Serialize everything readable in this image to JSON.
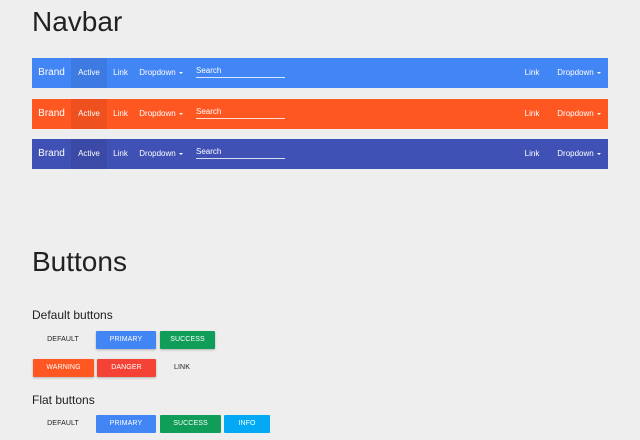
{
  "sections": {
    "navbar_title": "Navbar",
    "buttons_title": "Buttons",
    "default_buttons_title": "Default buttons",
    "flat_buttons_title": "Flat buttons"
  },
  "colors": {
    "navbar_blue": "#4285f4",
    "navbar_blue_active": "#3d7be2",
    "navbar_orange": "#ff5722",
    "navbar_orange_active": "#ef5020",
    "navbar_indigo": "#3f51b5",
    "navbar_indigo_active": "#3a4aa6",
    "primary": "#4285f4",
    "success": "#0f9d58",
    "warning": "#ff5722",
    "danger": "#f44336",
    "info": "#03a9f4"
  },
  "navbars": [
    {
      "brand": "Brand",
      "active": "Active",
      "link": "Link",
      "dropdown": "Dropdown",
      "search_placeholder": "Search",
      "right_link": "Link",
      "right_dropdown": "Dropdown"
    },
    {
      "brand": "Brand",
      "active": "Active",
      "link": "Link",
      "dropdown": "Dropdown",
      "search_placeholder": "Search",
      "right_link": "Link",
      "right_dropdown": "Dropdown"
    },
    {
      "brand": "Brand",
      "active": "Active",
      "link": "Link",
      "dropdown": "Dropdown",
      "search_placeholder": "Search",
      "right_link": "Link",
      "right_dropdown": "Dropdown"
    }
  ],
  "default_buttons": {
    "default": "DEFAULT",
    "primary": "PRIMARY",
    "success": "SUCCESS",
    "warning": "WARNING",
    "danger": "DANGER",
    "link": "LINK"
  },
  "flat_buttons": {
    "default": "DEFAULT",
    "primary": "PRIMARY",
    "success": "SUCCESS",
    "info": "INFO"
  }
}
